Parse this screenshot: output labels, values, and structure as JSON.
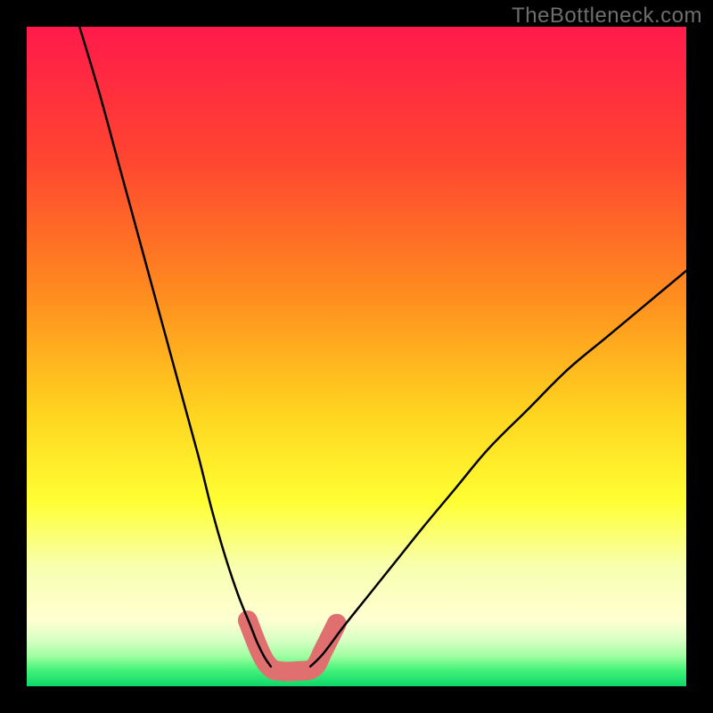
{
  "watermark": {
    "text": "TheBottleneck.com"
  },
  "chart_data": {
    "type": "line",
    "title": "",
    "xlabel": "",
    "ylabel": "",
    "xlim": [
      0,
      100
    ],
    "ylim": [
      0,
      100
    ],
    "grid": false,
    "legend": false,
    "background_gradient": {
      "stops": [
        {
          "offset": 0.0,
          "color": "#ff1a4b"
        },
        {
          "offset": 0.2,
          "color": "#ff4530"
        },
        {
          "offset": 0.4,
          "color": "#ff8a1f"
        },
        {
          "offset": 0.58,
          "color": "#ffd21f"
        },
        {
          "offset": 0.72,
          "color": "#ffff33"
        },
        {
          "offset": 0.82,
          "color": "#f8ffb0"
        },
        {
          "offset": 0.9,
          "color": "#ffffd1"
        },
        {
          "offset": 0.93,
          "color": "#d8ffc4"
        },
        {
          "offset": 0.955,
          "color": "#9dffa0"
        },
        {
          "offset": 0.975,
          "color": "#45f27a"
        },
        {
          "offset": 1.0,
          "color": "#0dd86a"
        }
      ]
    },
    "series": [
      {
        "name": "curve-left",
        "stroke": "#000000",
        "stroke_width": 2.5,
        "x": [
          8,
          11,
          14,
          17,
          20,
          23,
          26,
          28,
          30,
          32,
          34,
          35,
          36,
          37
        ],
        "y": [
          100,
          90,
          79,
          68,
          57,
          46,
          35,
          27,
          20,
          14,
          9,
          6.5,
          4.5,
          3
        ]
      },
      {
        "name": "curve-right",
        "stroke": "#000000",
        "stroke_width": 2.5,
        "x": [
          43,
          45,
          48,
          52,
          56,
          60,
          65,
          70,
          76,
          82,
          88,
          94,
          100
        ],
        "y": [
          3,
          5,
          9,
          14,
          19,
          24,
          30,
          36,
          42,
          48,
          53,
          58,
          63
        ]
      },
      {
        "name": "valley-marker",
        "type": "marker-path",
        "stroke": "#e07070",
        "stroke_width": 22,
        "x": [
          33.5,
          35.5,
          37,
          38.5,
          41,
          43.5,
          45,
          47
        ],
        "y": [
          10,
          5,
          2.8,
          2.3,
          2.3,
          2.8,
          5.5,
          9.5
        ]
      }
    ]
  }
}
